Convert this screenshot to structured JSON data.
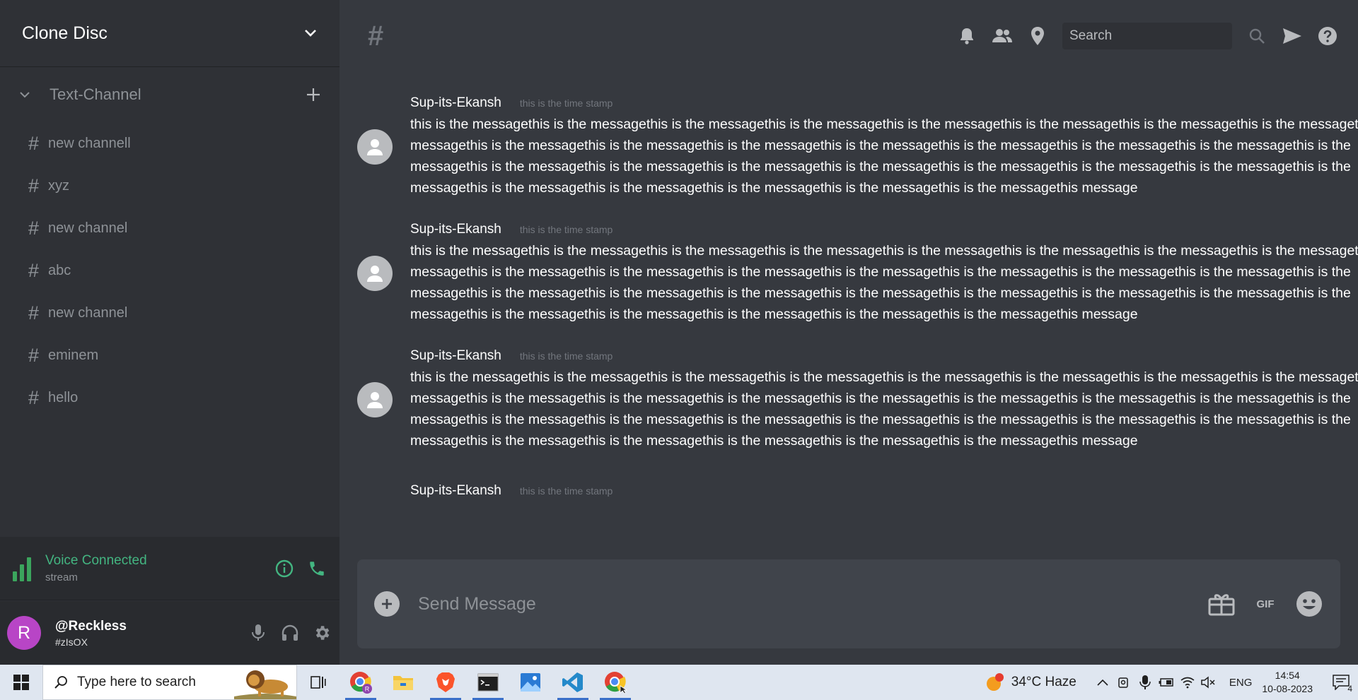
{
  "server": {
    "name": "Clone Disc"
  },
  "category": {
    "label": "Text-Channel"
  },
  "channels": [
    {
      "hash": "#",
      "label": "new channell"
    },
    {
      "hash": "#",
      "label": "xyz"
    },
    {
      "hash": "#",
      "label": "new channel"
    },
    {
      "hash": "#",
      "label": "abc"
    },
    {
      "hash": "#",
      "label": "new channel"
    },
    {
      "hash": "#",
      "label": "eminem"
    },
    {
      "hash": "#",
      "label": "hello"
    }
  ],
  "voice": {
    "title": "Voice Connected",
    "subtitle": "stream",
    "color": "#43b581"
  },
  "user": {
    "initial": "R",
    "name": "@Reckless",
    "tag": "#zIsOX",
    "avatar_color": "#b845c6"
  },
  "topbar": {
    "hash": "#",
    "search_placeholder": "Search"
  },
  "messages": [
    {
      "author": "Sup-its-Ekansh",
      "time": "this is the time stamp",
      "text": "this is the messagethis is the messagethis is the messagethis is the messagethis is the messagethis is the messagethis is the messagethis is the messagethis is the messagethis is the messagethis is the messagethis is the messagethis is the messagethis is the messagethis is the messagethis is the messagethis is the messagethis is the messagethis is the messagethis is the messagethis is the messagethis is the messagethis is the messagethis is the messagethis is the messagethis is the messagethis is the messagethis is the messagethis is the messagethis is the messagethis message"
    },
    {
      "author": "Sup-its-Ekansh",
      "time": "this is the time stamp",
      "text": "this is the messagethis is the messagethis is the messagethis is the messagethis is the messagethis is the messagethis is the messagethis is the messagethis is the messagethis is the messagethis is the messagethis is the messagethis is the messagethis is the messagethis is the messagethis is the messagethis is the messagethis is the messagethis is the messagethis is the messagethis is the messagethis is the messagethis is the messagethis is the messagethis is the messagethis is the messagethis is the messagethis is the messagethis is the messagethis is the messagethis message"
    },
    {
      "author": "Sup-its-Ekansh",
      "time": "this is the time stamp",
      "text": "this is the messagethis is the messagethis is the messagethis is the messagethis is the messagethis is the messagethis is the messagethis is the messagethis is the messagethis is the messagethis is the messagethis is the messagethis is the messagethis is the messagethis is the messagethis is the messagethis is the messagethis is the messagethis is the messagethis is the messagethis is the messagethis is the messagethis is the messagethis is the messagethis is the messagethis is the messagethis is the messagethis is the messagethis is the messagethis is the messagethis message"
    },
    {
      "author": "Sup-its-Ekansh",
      "time": "this is the time stamp",
      "text": ""
    }
  ],
  "composer": {
    "placeholder": "Send Message",
    "gif_label": "GIF"
  },
  "taskbar": {
    "search_placeholder": "Type here to search",
    "weather": "34°C  Haze",
    "weather_badge": "1",
    "lang": "ENG",
    "time": "14:54",
    "date": "10-08-2023",
    "notification_count": "4"
  },
  "icons": {
    "topbar": [
      "bell-icon",
      "members-icon",
      "pin-icon",
      "search-icon",
      "send-icon",
      "help-icon"
    ],
    "composer": [
      "add-icon",
      "gift-icon",
      "gif-icon",
      "emoji-icon"
    ],
    "user": [
      "mic-icon",
      "headphones-icon",
      "gear-icon"
    ],
    "voice": [
      "info-icon",
      "phone-icon"
    ]
  }
}
